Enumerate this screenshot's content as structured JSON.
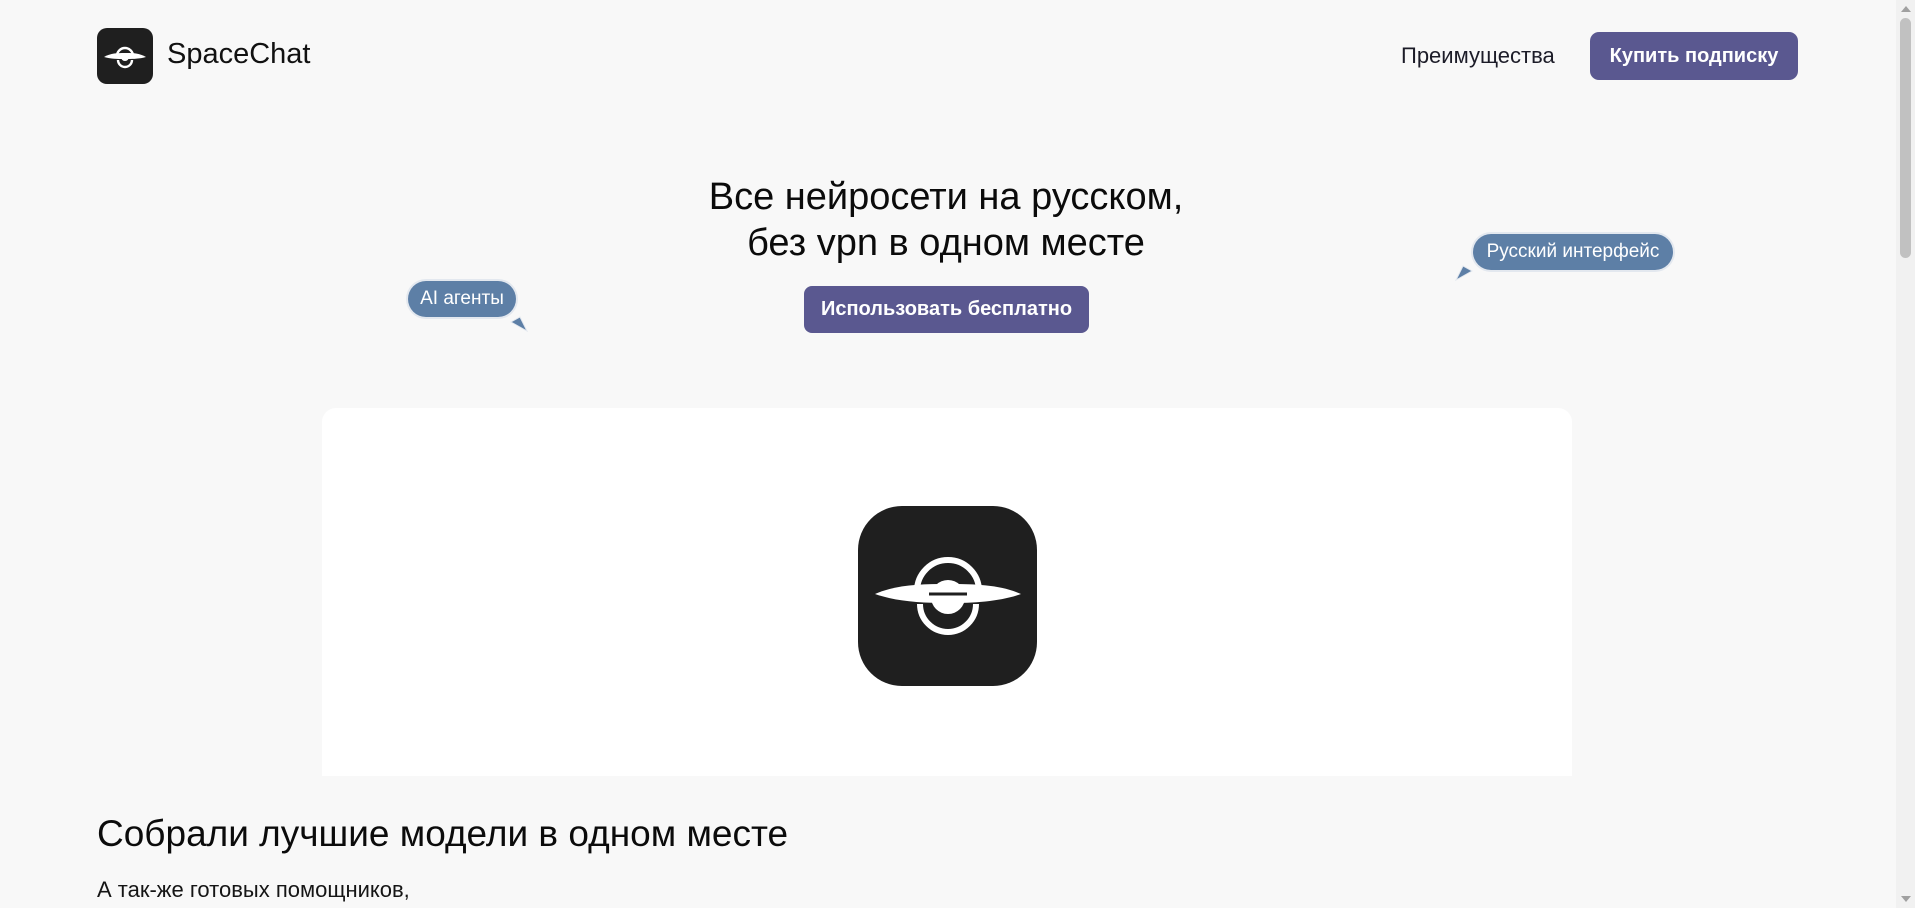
{
  "header": {
    "brand": "SpaceChat",
    "logo_icon": "planet-logo-icon",
    "nav_link": "Преимущества",
    "buy_button": "Купить подписку"
  },
  "hero": {
    "title_line1": "Все нейросети на русском,",
    "title_line2": "без vpn в одном месте",
    "cta_button": "Использовать бесплатно",
    "bubble_left": "AI агенты",
    "bubble_right": "Русский интерфейс"
  },
  "showcase": {
    "logo_icon": "planet-logo-icon"
  },
  "section": {
    "title": "Собрали лучшие модели в одном месте",
    "subtitle": "А так-же готовых помощников,"
  },
  "colors": {
    "accent": "#5a5890",
    "bubble": "#5d7fa6",
    "logo_bg": "#1f1f1f",
    "page_bg": "#f8f8f8"
  }
}
